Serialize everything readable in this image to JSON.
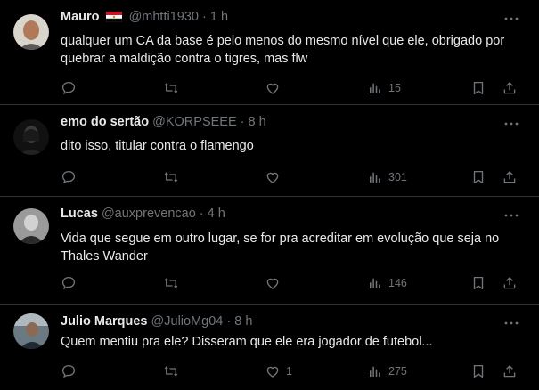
{
  "tweets": [
    {
      "name": "Mauro",
      "flag": "egypt-flag",
      "handle": "@mhtti1930",
      "time": "1 h",
      "text": "qualquer um CA da base é pelo menos do mesmo nível que ele, obrigado por quebrar a maldição contra o tigres, mas flw",
      "reply_count": "",
      "retweet_count": "",
      "like_count": "",
      "views": "15"
    },
    {
      "name": "emo do sertão",
      "handle": "@KORPSEEE",
      "time": "8 h",
      "text": "dito isso, titular contra o flamengo",
      "reply_count": "",
      "retweet_count": "",
      "like_count": "",
      "views": "301"
    },
    {
      "name": "Lucas",
      "handle": "@auxprevencao",
      "time": "4 h",
      "text": "Vida que segue em outro lugar, se for pra acreditar em evolução que seja no Thales Wander",
      "reply_count": "",
      "retweet_count": "",
      "like_count": "",
      "views": "146"
    },
    {
      "name": "Julio Marques",
      "handle": "@JulioMg04",
      "time": "8 h",
      "text": "Quem mentiu pra ele? Disseram que ele era jogador de futebol...",
      "reply_count": "",
      "retweet_count": "",
      "like_count": "1",
      "views": "275"
    }
  ],
  "separator": "·",
  "colors": {
    "background": "#000000",
    "text": "#e7e9ea",
    "muted": "#71767b",
    "border": "#2f3336"
  }
}
